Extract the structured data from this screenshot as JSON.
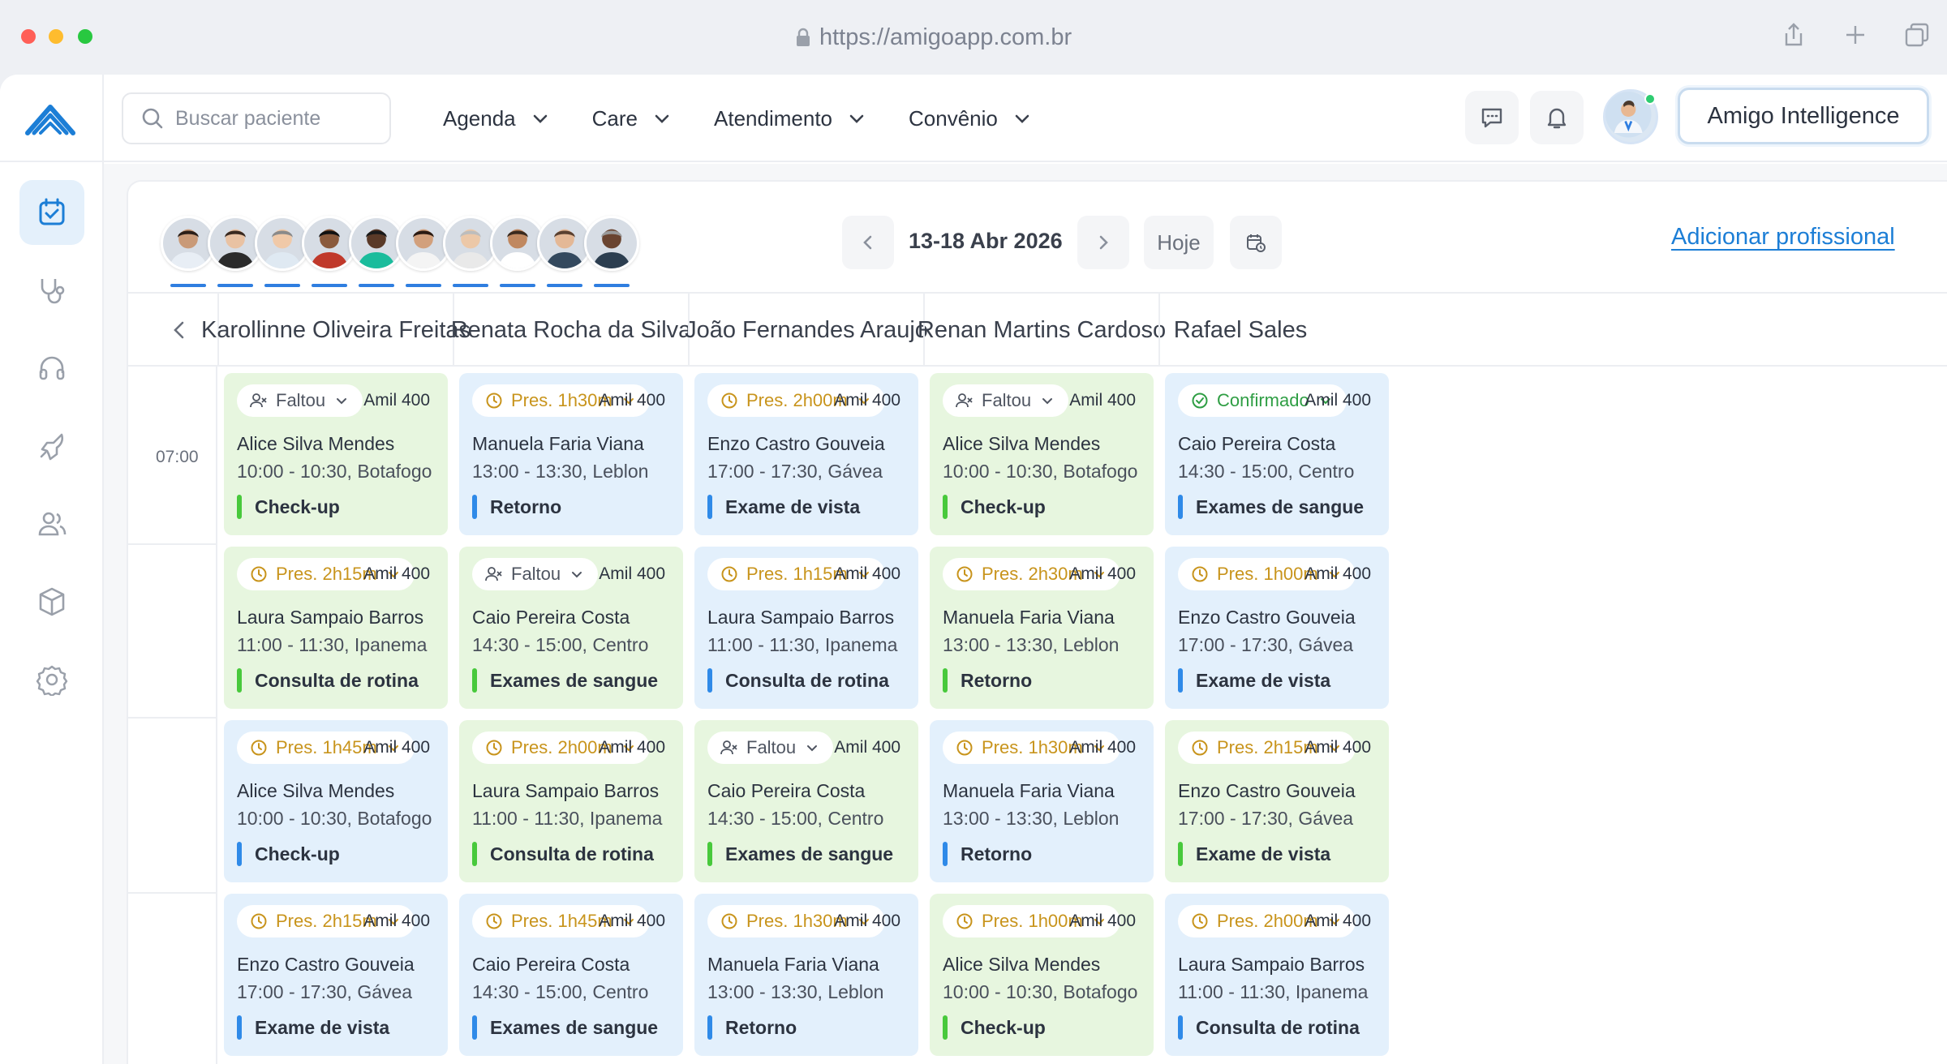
{
  "browser": {
    "url": "https://amigoapp.com.br",
    "actions": [
      "share-icon",
      "new-tab-icon",
      "tabs-icon"
    ]
  },
  "sidebar": {
    "items": [
      {
        "name": "agenda",
        "icon": "calendar-check-icon",
        "active": true
      },
      {
        "name": "care",
        "icon": "stethoscope-icon",
        "active": false
      },
      {
        "name": "atendimento",
        "icon": "headset-icon",
        "active": false
      },
      {
        "name": "marketing",
        "icon": "rocket-icon",
        "active": false
      },
      {
        "name": "usuarios",
        "icon": "users-icon",
        "active": false
      },
      {
        "name": "estoque",
        "icon": "box-icon",
        "active": false
      },
      {
        "name": "configuracoes",
        "icon": "gear-icon",
        "active": false
      }
    ]
  },
  "topbar": {
    "search_placeholder": "Buscar paciente",
    "nav": [
      {
        "label": "Agenda"
      },
      {
        "label": "Care"
      },
      {
        "label": "Atendimento"
      },
      {
        "label": "Convênio"
      }
    ],
    "ai_button": "Amigo Intelligence"
  },
  "schedule": {
    "date_range": "13-18 Abr 2026",
    "today_label": "Hoje",
    "add_professional": "Adicionar profissional",
    "time_label": "07:00",
    "professionals": [
      "Karollinne Oliveira Freitas",
      "Renata Rocha da Silva",
      "João Fernandes Araujo",
      "Renan Martins Cardoso",
      "Rafael Sales"
    ],
    "columns": [
      [
        {
          "status": "faltou",
          "status_label": "Faltou",
          "plan": "Amil 400",
          "patient": "Alice Silva Mendes",
          "time": "10:00 - 10:30, Botafogo",
          "type": "Check-up",
          "color": "green"
        },
        {
          "status": "pres",
          "status_label": "Pres.  2h15m",
          "plan": "Amil 400",
          "patient": "Laura Sampaio Barros",
          "time": "11:00 - 11:30, Ipanema",
          "type": "Consulta de rotina",
          "color": "green"
        },
        {
          "status": "pres",
          "status_label": "Pres.  1h45m",
          "plan": "Amil 400",
          "patient": "Alice Silva Mendes",
          "time": "10:00 - 10:30, Botafogo",
          "type": "Check-up",
          "color": "blue"
        },
        {
          "status": "pres",
          "status_label": "Pres.  2h15m",
          "plan": "Amil 400",
          "patient": "Enzo Castro Gouveia",
          "time": "17:00 - 17:30, Gávea",
          "type": "Exame de vista",
          "color": "blue"
        }
      ],
      [
        {
          "status": "pres",
          "status_label": "Pres.  1h30m",
          "plan": "Amil 400",
          "patient": "Manuela Faria Viana",
          "time": "13:00 - 13:30, Leblon",
          "type": "Retorno",
          "color": "blue"
        },
        {
          "status": "faltou",
          "status_label": "Faltou",
          "plan": "Amil 400",
          "patient": "Caio Pereira Costa",
          "time": "14:30 - 15:00, Centro",
          "type": "Exames de sangue",
          "color": "green"
        },
        {
          "status": "pres",
          "status_label": "Pres.  2h00m",
          "plan": "Amil 400",
          "patient": "Laura Sampaio Barros",
          "time": "11:00 - 11:30, Ipanema",
          "type": "Consulta de rotina",
          "color": "green"
        },
        {
          "status": "pres",
          "status_label": "Pres.  1h45m",
          "plan": "Amil 400",
          "patient": "Caio Pereira Costa",
          "time": "14:30 - 15:00, Centro",
          "type": "Exames de sangue",
          "color": "blue"
        }
      ],
      [
        {
          "status": "pres",
          "status_label": "Pres.  2h00m",
          "plan": "Amil 400",
          "patient": "Enzo Castro Gouveia",
          "time": "17:00 - 17:30, Gávea",
          "type": "Exame de vista",
          "color": "blue"
        },
        {
          "status": "pres",
          "status_label": "Pres.  1h15m",
          "plan": "Amil 400",
          "patient": "Laura Sampaio Barros",
          "time": "11:00 - 11:30, Ipanema",
          "type": "Consulta de rotina",
          "color": "blue"
        },
        {
          "status": "faltou",
          "status_label": "Faltou",
          "plan": "Amil 400",
          "patient": "Caio Pereira Costa",
          "time": "14:30 - 15:00, Centro",
          "type": "Exames de sangue",
          "color": "green"
        },
        {
          "status": "pres",
          "status_label": "Pres.  1h30m",
          "plan": "Amil 400",
          "patient": "Manuela Faria Viana",
          "time": "13:00 - 13:30, Leblon",
          "type": "Retorno",
          "color": "blue"
        }
      ],
      [
        {
          "status": "faltou",
          "status_label": "Faltou",
          "plan": "Amil 400",
          "patient": "Alice Silva Mendes",
          "time": "10:00 - 10:30, Botafogo",
          "type": "Check-up",
          "color": "green"
        },
        {
          "status": "pres",
          "status_label": "Pres.  2h30m",
          "plan": "Amil 400",
          "patient": "Manuela Faria Viana",
          "time": "13:00 - 13:30, Leblon",
          "type": "Retorno",
          "color": "green"
        },
        {
          "status": "pres",
          "status_label": "Pres.  1h30m",
          "plan": "Amil 400",
          "patient": "Manuela Faria Viana",
          "time": "13:00 - 13:30, Leblon",
          "type": "Retorno",
          "color": "blue"
        },
        {
          "status": "pres",
          "status_label": "Pres.  1h00m",
          "plan": "Amil 400",
          "patient": "Alice Silva Mendes",
          "time": "10:00 - 10:30, Botafogo",
          "type": "Check-up",
          "color": "green"
        }
      ],
      [
        {
          "status": "confirmado",
          "status_label": "Confirmado",
          "plan": "Amil 400",
          "patient": "Caio Pereira Costa",
          "time": "14:30 - 15:00, Centro",
          "type": "Exames de sangue",
          "color": "blue"
        },
        {
          "status": "pres",
          "status_label": "Pres.  1h00m",
          "plan": "Amil 400",
          "patient": "Enzo Castro Gouveia",
          "time": "17:00 - 17:30, Gávea",
          "type": "Exame de vista",
          "color": "blue"
        },
        {
          "status": "pres",
          "status_label": "Pres.  2h15m",
          "plan": "Amil 400",
          "patient": "Enzo Castro Gouveia",
          "time": "17:00 - 17:30, Gávea",
          "type": "Exame de vista",
          "color": "green"
        },
        {
          "status": "pres",
          "status_label": "Pres.  2h00m",
          "plan": "Amil 400",
          "patient": "Laura Sampaio Barros",
          "time": "11:00 - 11:30, Ipanema",
          "type": "Consulta de rotina",
          "color": "blue"
        }
      ]
    ]
  },
  "colors": {
    "accent": "#1c7ed6",
    "card_green": "#e7f6df",
    "card_blue": "#e3f0fc",
    "pres": "#c8941c",
    "confirmado": "#2f9e44"
  }
}
